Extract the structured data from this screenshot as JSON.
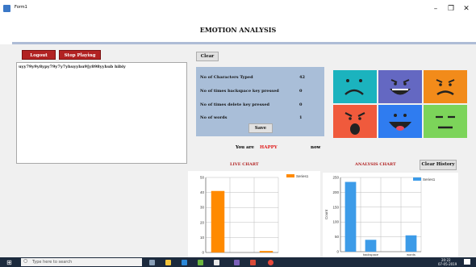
{
  "window": {
    "title": "Form1",
    "minimize": "–",
    "maximize": "❐",
    "close": "✕"
  },
  "app": {
    "title": "EMOTION ANALYSIS"
  },
  "buttons": {
    "logout": "Logout",
    "stop_playing": "Stop Playing",
    "clear": "Clear",
    "save": "Save",
    "clear_history": "Clear History"
  },
  "typed_text": "uyy79y9y8ypy79y7y7yhuyyhu9[y898yyhub hibiy",
  "stats": [
    {
      "label": "No of Characters Typed",
      "value": "42"
    },
    {
      "label": "No of times backspace key pressed",
      "value": "0"
    },
    {
      "label": "No of times delete key pressed",
      "value": "0"
    },
    {
      "label": "No of words",
      "value": "1"
    }
  ],
  "status": {
    "prefix": "You are",
    "emotion": "HAPPY",
    "suffix": "now"
  },
  "emotion_tiles": [
    {
      "name": "sad",
      "color": "#1bb3be"
    },
    {
      "name": "laughing",
      "color": "#6468c2"
    },
    {
      "name": "worried",
      "color": "#f28b1a"
    },
    {
      "name": "angry",
      "color": "#f05a3c"
    },
    {
      "name": "happy-tongue",
      "color": "#2f7cf0"
    },
    {
      "name": "meh",
      "color": "#7cd45a"
    }
  ],
  "live_chart": {
    "title": "LIVE CHART"
  },
  "analysis_chart": {
    "title": "ANALYSIS CHART"
  },
  "chart_data": [
    {
      "type": "bar",
      "title": "LIVE CHART",
      "categories": [
        "c1",
        "c2",
        "c3"
      ],
      "tick_labels": [
        "",
        "",
        ""
      ],
      "series": [
        {
          "name": "Series1",
          "values": [
            41,
            0,
            1
          ],
          "color": "#ff8a00"
        }
      ],
      "ylim": [
        0,
        50
      ],
      "yticks": [
        0,
        10,
        20,
        30,
        40,
        50
      ],
      "xlabel": "",
      "ylabel": "",
      "grid": true,
      "legend": "top-right"
    },
    {
      "type": "bar",
      "title": "ANALYSIS CHART",
      "categories": [
        "c1",
        "c2",
        "c3",
        "c4"
      ],
      "tick_labels": [
        "",
        "backspace",
        "",
        "words"
      ],
      "series": [
        {
          "name": "Series1",
          "values": [
            235,
            40,
            0,
            55
          ],
          "color": "#3c9be8"
        }
      ],
      "ylim": [
        0,
        250
      ],
      "yticks": [
        0,
        50,
        100,
        150,
        200,
        250
      ],
      "xlabel": "",
      "ylabel": "Count",
      "grid": true,
      "legend": "top-right"
    }
  ],
  "taskbar": {
    "search_placeholder": "Type here to search",
    "time": "20:22",
    "date": "07-05-2019"
  }
}
